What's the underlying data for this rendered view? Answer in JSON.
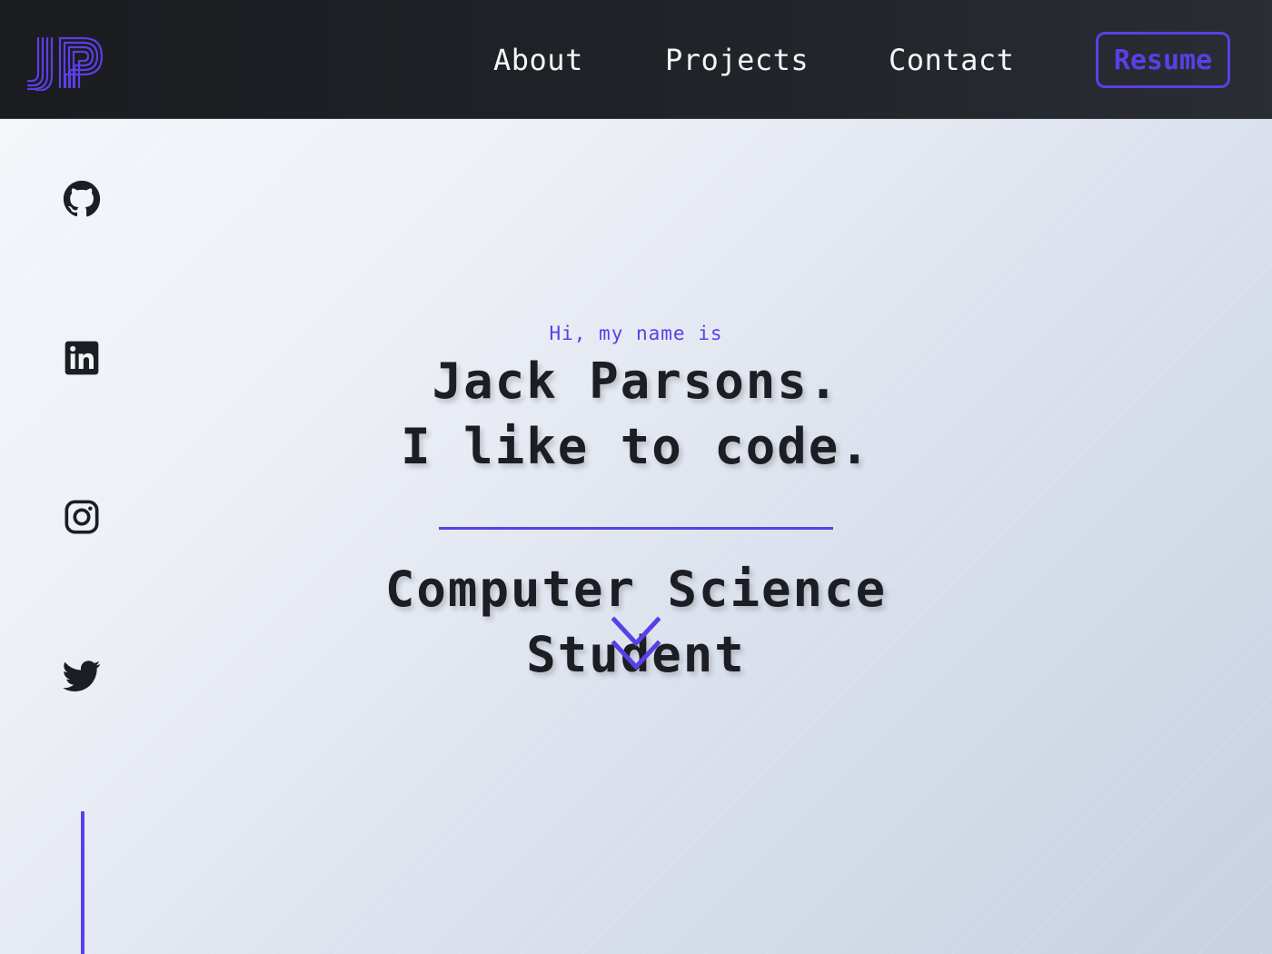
{
  "header": {
    "logo_text": "JP",
    "nav": [
      {
        "label": "About"
      },
      {
        "label": "Projects"
      },
      {
        "label": "Contact"
      }
    ],
    "resume_label": "Resume"
  },
  "social": [
    {
      "icon": "github-icon"
    },
    {
      "icon": "linkedin-icon"
    },
    {
      "icon": "instagram-icon"
    },
    {
      "icon": "twitter-icon"
    }
  ],
  "hero": {
    "greeting": "Hi, my name is",
    "name": "Jack Parsons.",
    "tagline": "I like to code.",
    "role_line1": "Computer Science",
    "role_line2": "Student"
  },
  "colors": {
    "accent": "#5b3fe6",
    "header_bg": "#1d1f24",
    "text_dark": "#1c1e23"
  }
}
